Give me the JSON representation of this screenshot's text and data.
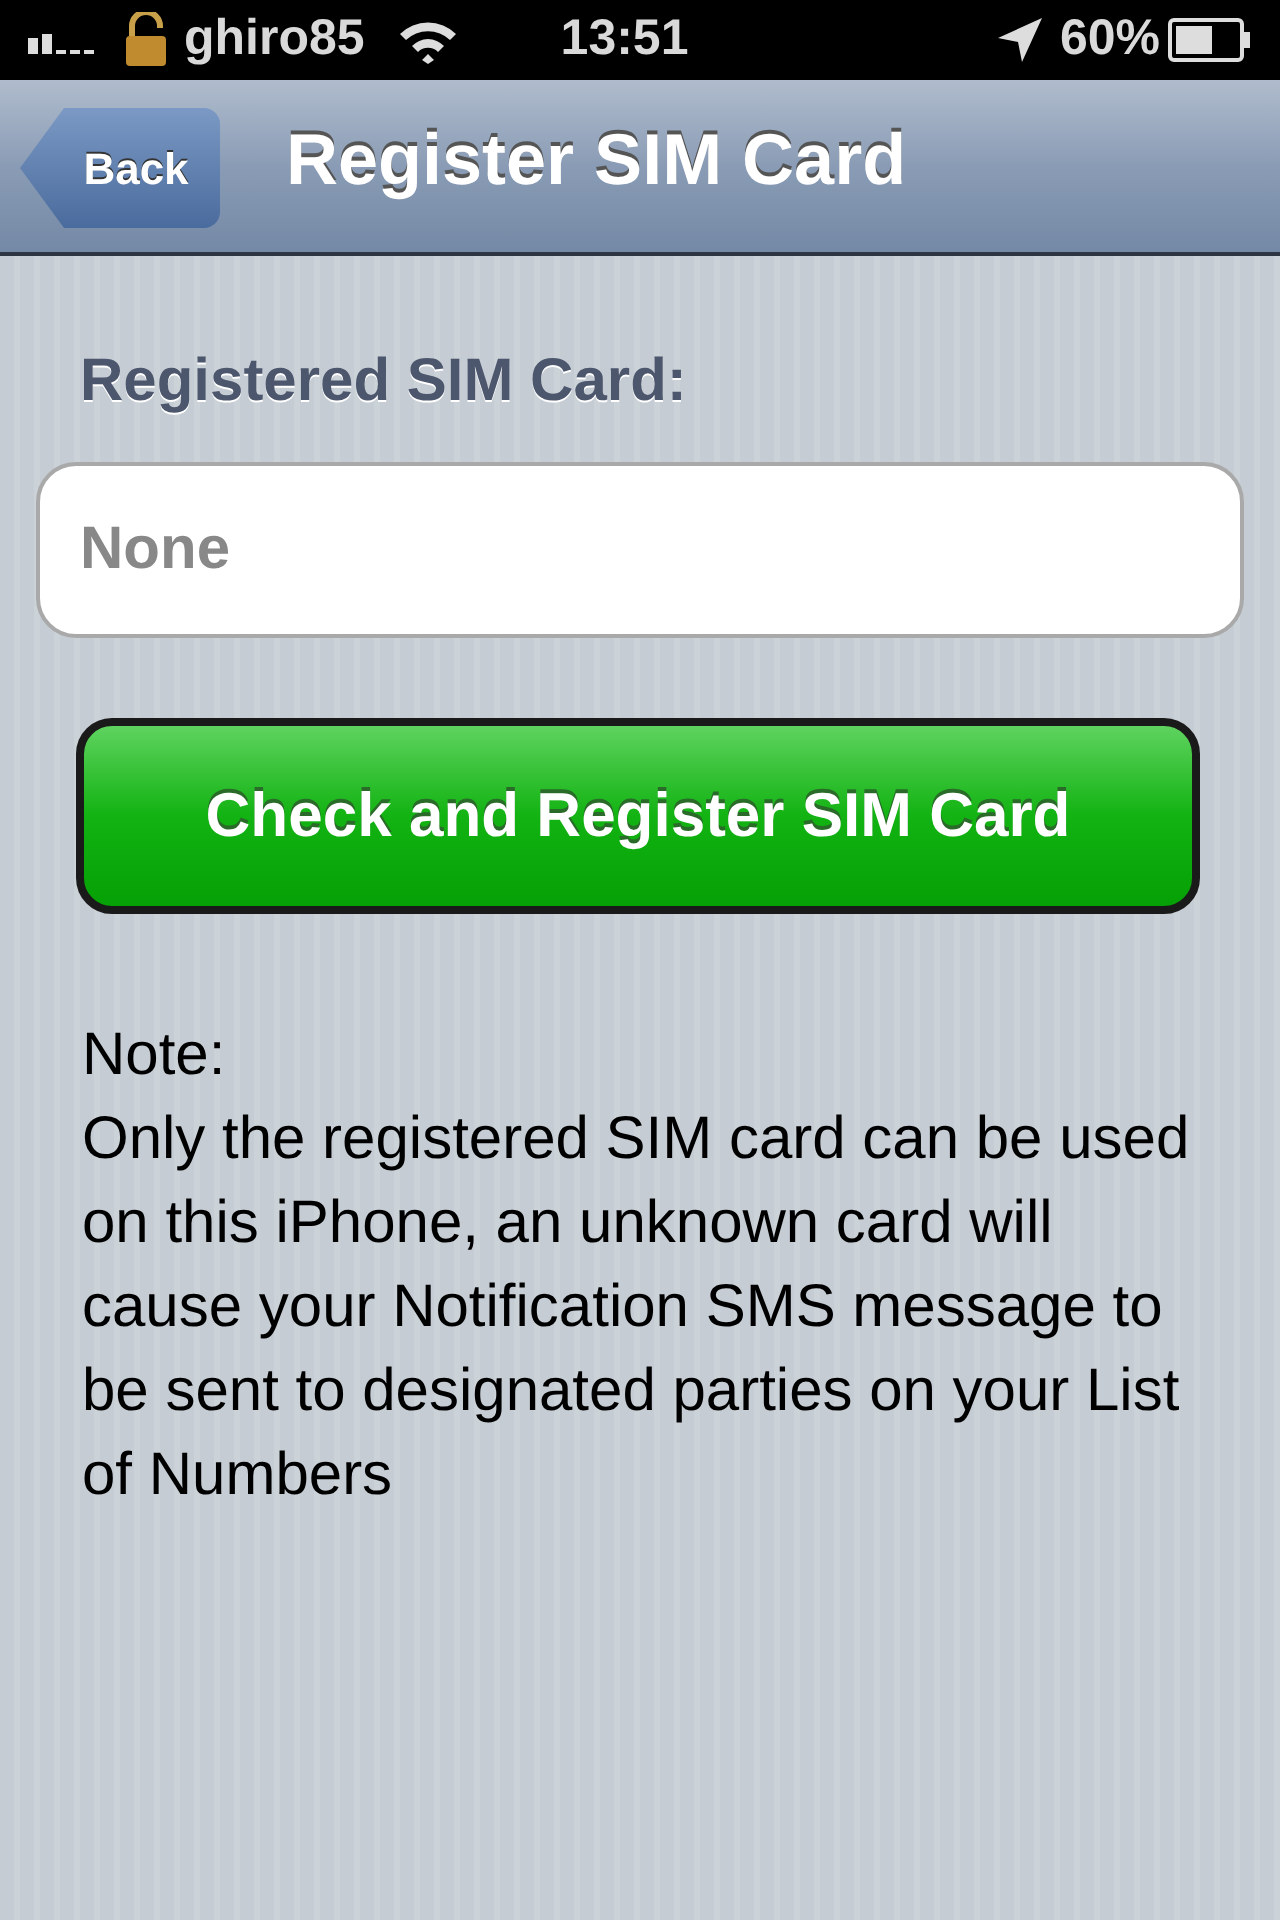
{
  "status_bar": {
    "carrier": "ghiro85",
    "time": "13:51",
    "battery": "60%"
  },
  "nav_bar": {
    "back": "Back",
    "title": "Register SIM Card"
  },
  "field": {
    "label": "Registered SIM Card:",
    "placeholder": "None"
  },
  "button": "Check and Register SIM Card",
  "note": {
    "heading": "Note:",
    "text": "Only the registered SIM card can be used on this iPhone, an unknown card will cause your Notification SMS message to be sent to designated parties on your List of Numbers"
  }
}
